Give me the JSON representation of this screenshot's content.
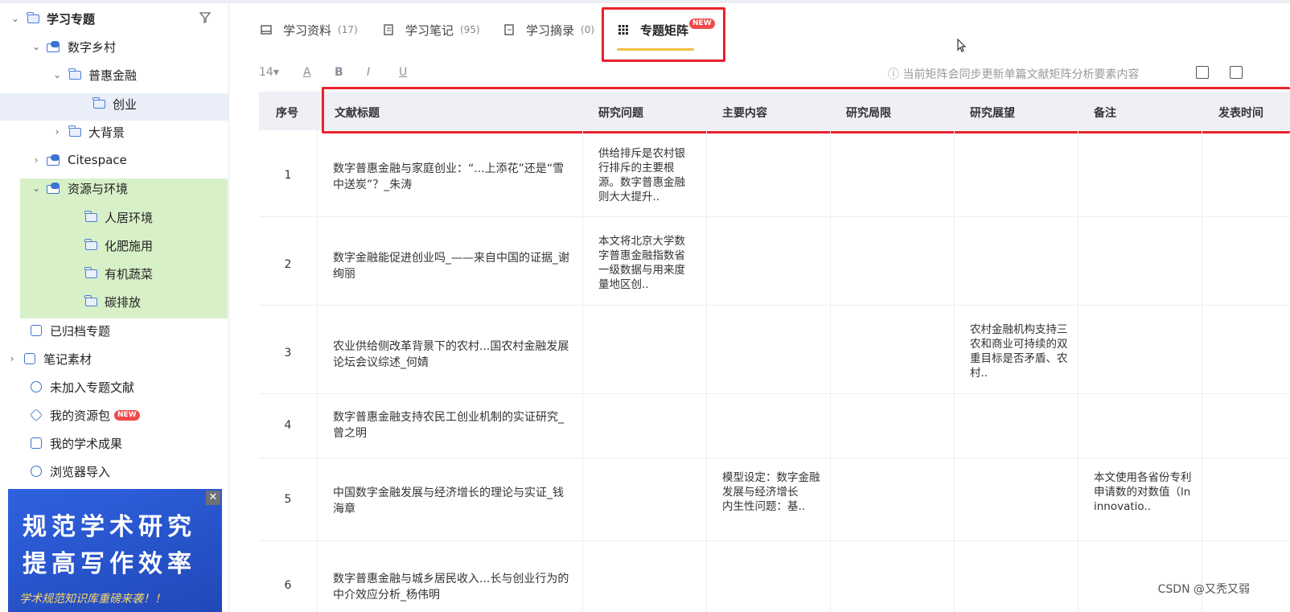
{
  "sidebar": {
    "items": [
      {
        "label": "学习专题",
        "chevron": "⌄"
      },
      {
        "label": "数字乡村",
        "chevron": "⌄"
      },
      {
        "label": "普惠金融",
        "chevron": "⌄"
      },
      {
        "label": "创业",
        "chevron": ""
      },
      {
        "label": "大背景",
        "chevron": "›"
      },
      {
        "label": "Citespace",
        "chevron": "›"
      },
      {
        "label": "资源与环境",
        "chevron": "⌄"
      },
      {
        "label": "人居环境",
        "chevron": ""
      },
      {
        "label": "化肥施用",
        "chevron": ""
      },
      {
        "label": "有机蔬菜",
        "chevron": ""
      },
      {
        "label": "碳排放",
        "chevron": ""
      },
      {
        "label": "已归档专题",
        "chevron": ""
      },
      {
        "label": "笔记素材",
        "chevron": "›"
      },
      {
        "label": "未加入专题文献",
        "chevron": ""
      },
      {
        "label": "我的资源包",
        "chevron": "",
        "badge": "NEW"
      },
      {
        "label": "我的学术成果",
        "chevron": ""
      },
      {
        "label": "浏览器导入",
        "chevron": ""
      }
    ],
    "banner": {
      "line1": "规范学术研究",
      "line2": "提高写作效率",
      "line3": "学术规范知识库重磅来袭！！",
      "close": "✕"
    }
  },
  "tabs": [
    {
      "label": "学习资料",
      "count": "(17)"
    },
    {
      "label": "学习笔记",
      "count": "(95)"
    },
    {
      "label": "学习摘录",
      "count": "(0)"
    },
    {
      "label": "专题矩阵",
      "badge": "NEW"
    }
  ],
  "toolbar": {
    "font_size": "14▾",
    "btn_a": "A",
    "btn_b": "B",
    "btn_i": "I",
    "btn_u": "U",
    "notice": "ⓘ 当前矩阵会同步更新单篇文献矩阵分析要素内容"
  },
  "table": {
    "headers": [
      "序号",
      "文献标题",
      "研究问题",
      "主要内容",
      "研究局限",
      "研究展望",
      "备注",
      "发表时间"
    ],
    "rows": [
      {
        "seq": "1",
        "title": "数字普惠金融与家庭创业：“...上添花”还是“雪中送炭”？_朱涛",
        "question": "供给排斥是农村银行排斥的主要根源。数字普惠金融则大大提升..",
        "content": "",
        "limit": "",
        "outlook": "",
        "remark": ""
      },
      {
        "seq": "2",
        "title": "数字金融能促进创业吗_——来自中国的证据_谢绚丽",
        "question": "本文将北京大学数字普惠金融指数省一级数据与用来度量地区创..",
        "content": "",
        "limit": "",
        "outlook": "",
        "remark": ""
      },
      {
        "seq": "3",
        "title": "农业供给侧改革背景下的农村...国农村金融发展论坛会议综述_何婧",
        "question": "",
        "content": "",
        "limit": "",
        "outlook": "农村金融机构支持三农和商业可持续的双重目标是否矛盾、农村..",
        "remark": ""
      },
      {
        "seq": "4",
        "title": "数字普惠金融支持农民工创业机制的实证研究_曾之明",
        "question": "",
        "content": "",
        "limit": "",
        "outlook": "",
        "remark": ""
      },
      {
        "seq": "5",
        "title": "中国数字金融发展与经济增长的理论与实证_钱海章",
        "question": "",
        "content": "模型设定：数字金融发展与经济增长\n内生性问题：基..",
        "limit": "",
        "outlook": "",
        "remark": "本文使用各省份专利申请数的对数值（lninnovatio.."
      },
      {
        "seq": "6",
        "title": "数字普惠金融与城乡居民收入...长与创业行为的中介效应分析_杨伟明",
        "question": "",
        "content": "",
        "limit": "",
        "outlook": "",
        "remark": ""
      }
    ]
  },
  "watermark": "CSDN @又秃又弱",
  "colors": {
    "accent": "#f5c042",
    "highlight_red": "#e8222a",
    "green_block": "#d8f0c8",
    "selected": "#e9eef9"
  }
}
